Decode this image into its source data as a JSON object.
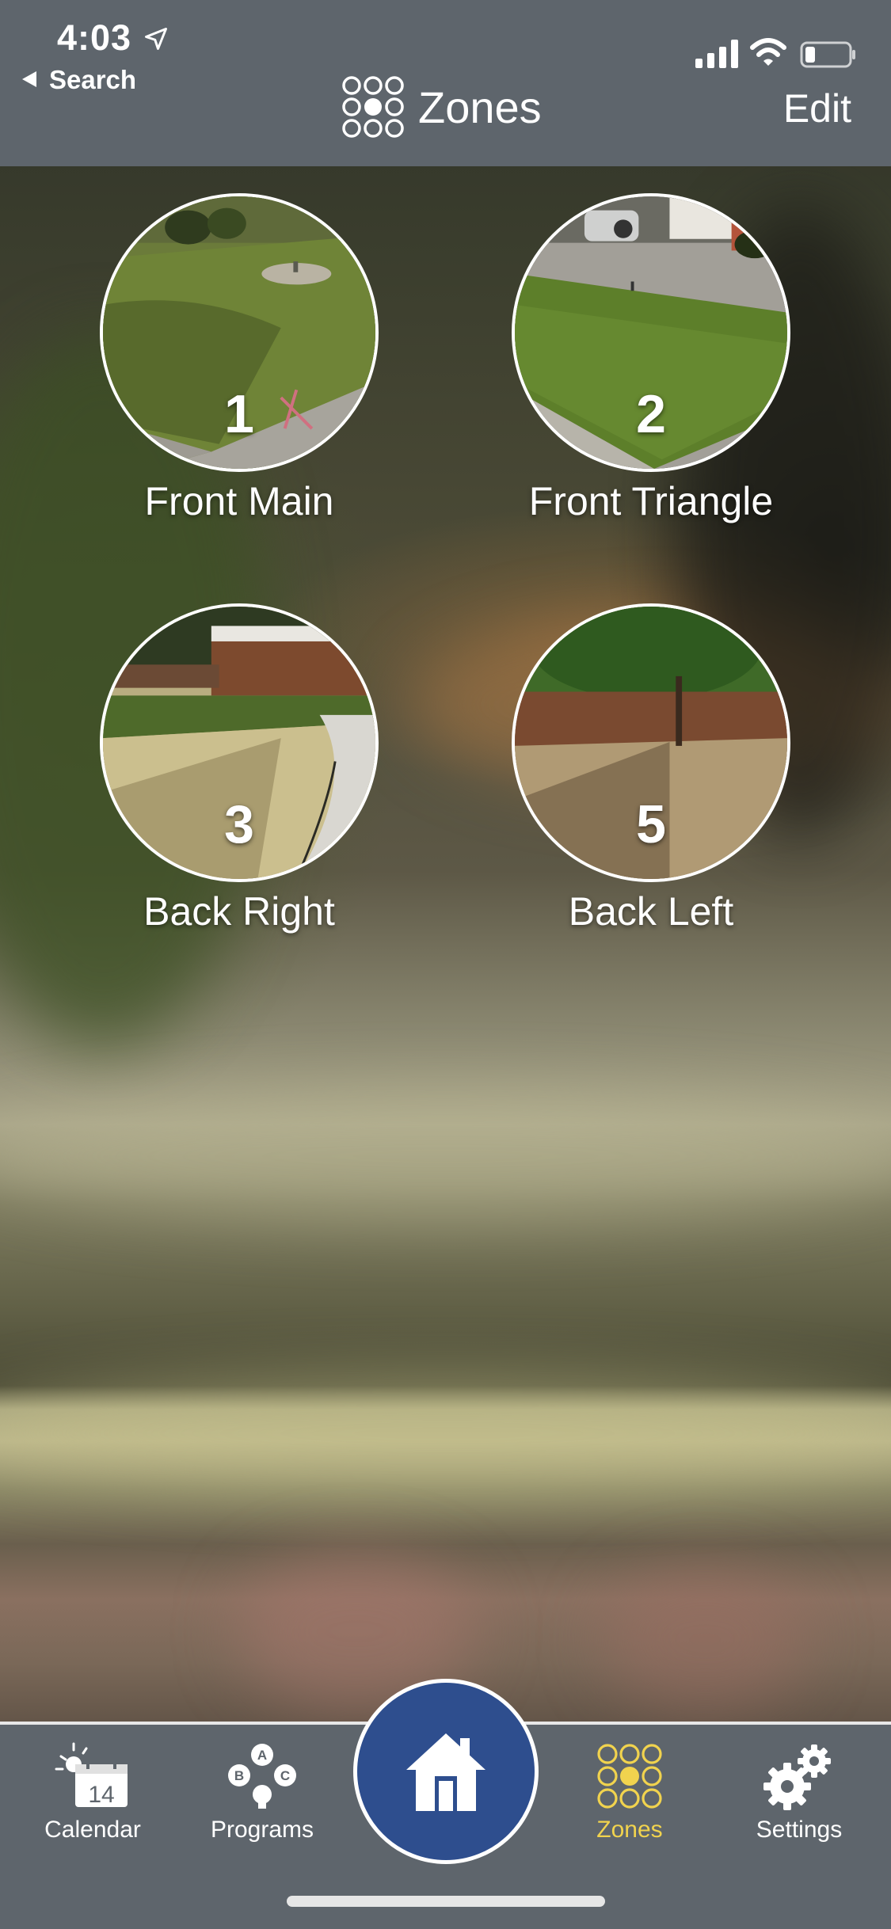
{
  "status_bar": {
    "time": "4:03",
    "back_label": "Search"
  },
  "nav": {
    "title": "Zones",
    "edit_label": "Edit"
  },
  "zones": [
    {
      "number": "1",
      "name": "Front Main"
    },
    {
      "number": "2",
      "name": "Front Triangle"
    },
    {
      "number": "3",
      "name": "Back Right"
    },
    {
      "number": "5",
      "name": "Back Left"
    }
  ],
  "tabbar": {
    "calendar": {
      "label": "Calendar",
      "day": "14"
    },
    "programs": {
      "label": "Programs",
      "a": "A",
      "b": "B",
      "c": "C"
    },
    "zones": {
      "label": "Zones"
    },
    "settings": {
      "label": "Settings"
    }
  },
  "colors": {
    "bar": "#5e656c",
    "home_button": "#2e4e8e",
    "active_tab": "#f1d34e"
  },
  "icons": [
    "location-arrow-icon",
    "signal-icon",
    "wifi-icon",
    "battery-icon",
    "zones-logo-icon",
    "calendar-icon",
    "programs-icon",
    "home-icon",
    "zones-icon",
    "settings-icon"
  ]
}
